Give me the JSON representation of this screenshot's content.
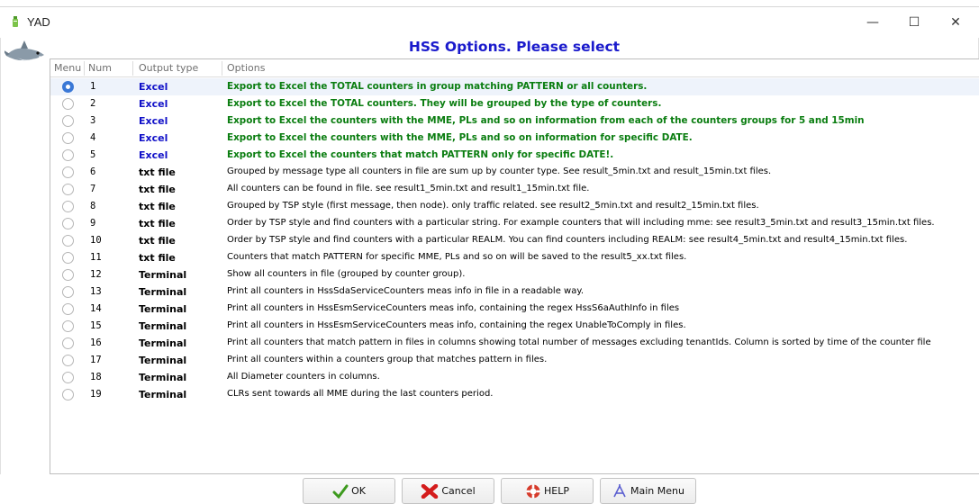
{
  "window": {
    "title": "YAD",
    "minimize_glyph": "—",
    "maximize_glyph": "☐",
    "close_glyph": "✕"
  },
  "dialog": {
    "header": "HSS Options. Please select"
  },
  "columns": {
    "menu": "Menu",
    "num": "Num",
    "output_type": "Output type",
    "options": "Options"
  },
  "colors": {
    "header_blue": "#1a1acc",
    "excel_blue": "#1010c8",
    "green_text": "#0a7d10",
    "radio_selected": "#3a78d6"
  },
  "rows": [
    {
      "num": "1",
      "type": "Excel",
      "option": "Export to Excel the TOTAL counters in group matching PATTERN or all counters.",
      "selected": true
    },
    {
      "num": "2",
      "type": "Excel",
      "option": "Export to Excel the TOTAL counters. They will be grouped by the type of counters.",
      "selected": false
    },
    {
      "num": "3",
      "type": "Excel",
      "option": "Export to Excel the counters with the MME, PLs and so on information from each of the counters groups for 5 and 15min",
      "selected": false
    },
    {
      "num": "4",
      "type": "Excel",
      "option": "Export to Excel the counters with the MME, PLs and so on information for specific DATE.",
      "selected": false
    },
    {
      "num": "5",
      "type": "Excel",
      "option": "Export to Excel the counters that match PATTERN only for specific DATE!.",
      "selected": false
    },
    {
      "num": "6",
      "type": "txt file",
      "option": "Grouped by message type all counters in file are sum up by counter type. See result_5min.txt and result_15min.txt files.",
      "selected": false
    },
    {
      "num": "7",
      "type": "txt file",
      "option": "All counters can be found in file. see result1_5min.txt and result1_15min.txt file.",
      "selected": false
    },
    {
      "num": "8",
      "type": "txt file",
      "option": "Grouped by TSP style (first message, then node). only traffic related. see result2_5min.txt and result2_15min.txt files.",
      "selected": false
    },
    {
      "num": "9",
      "type": "txt file",
      "option": "Order by TSP style and find counters with a particular string. For example counters that will including mme: see result3_5min.txt and result3_15min.txt files.",
      "selected": false
    },
    {
      "num": "10",
      "type": "txt file",
      "option": "Order by TSP style and find counters with a particular REALM. You can find counters including REALM: see result4_5min.txt and result4_15min.txt files.",
      "selected": false
    },
    {
      "num": "11",
      "type": "txt file",
      "option": "Counters that match PATTERN for specific MME, PLs and so on will be saved to the result5_xx.txt files.",
      "selected": false
    },
    {
      "num": "12",
      "type": "Terminal",
      "option": "Show  all counters in file (grouped by counter group).",
      "selected": false
    },
    {
      "num": "13",
      "type": "Terminal",
      "option": "Print all counters in HssSdaServiceCounters meas info in file in a readable way.",
      "selected": false
    },
    {
      "num": "14",
      "type": "Terminal",
      "option": "Print all counters in HssEsmServiceCounters meas info, containing the regex HssS6aAuthInfo in files",
      "selected": false
    },
    {
      "num": "15",
      "type": "Terminal",
      "option": "Print all counters in HssEsmServiceCounters meas info, containing the regex UnableToComply in files.",
      "selected": false
    },
    {
      "num": "16",
      "type": "Terminal",
      "option": "Print all counters that match pattern in files in columns showing total number of messages excluding tenantIds. Column is sorted by time of the counter file",
      "selected": false
    },
    {
      "num": "17",
      "type": "Terminal",
      "option": "Print all counters within a counters group that matches pattern in files.",
      "selected": false
    },
    {
      "num": "18",
      "type": "Terminal",
      "option": "All Diameter counters in columns.",
      "selected": false
    },
    {
      "num": "19",
      "type": "Terminal",
      "option": "CLRs sent towards all MME during the last counters period.",
      "selected": false
    }
  ],
  "buttons": {
    "ok": "OK",
    "cancel": "Cancel",
    "help": "HELP",
    "main_menu": "Main Menu"
  }
}
